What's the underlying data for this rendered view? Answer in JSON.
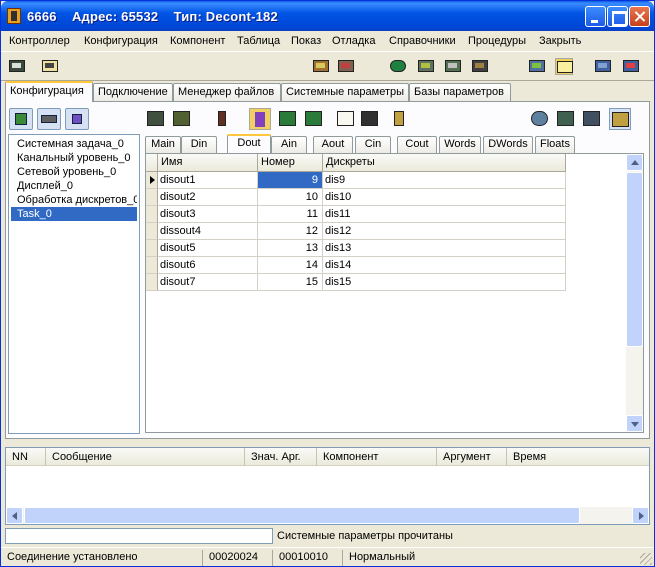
{
  "window": {
    "title": "6666    Адрес: 65532    Тип: Decont-182"
  },
  "menu": [
    "Контроллер",
    "Конфигурация",
    "Компонент",
    "Таблица",
    "Показ",
    "Отладка",
    "Справочники",
    "Процедуры",
    "Закрыть"
  ],
  "main_tabs": [
    "Конфигурация",
    "Подключение",
    "Менеджер файлов",
    "Системные параметры",
    "Базы параметров"
  ],
  "left_list": [
    "Системная задача_0",
    "Канальный уровень_0",
    "Сетевой уровень_0",
    "Дисплей_0",
    "Обработка дискретов_0",
    "Task_0"
  ],
  "left_selected": "Task_0",
  "sub_tabs": [
    "Main",
    "Din",
    "Dout",
    "Ain",
    "Aout",
    "Cin",
    "Cout",
    "Words",
    "DWords",
    "Floats"
  ],
  "active_sub_tab": "Dout",
  "grid": {
    "headers": [
      "Имя",
      "Номер",
      "Дискреты"
    ],
    "rows": [
      {
        "name": "disout1",
        "num": "9",
        "disc": "dis9"
      },
      {
        "name": "disout2",
        "num": "10",
        "disc": "dis10"
      },
      {
        "name": "disout3",
        "num": "11",
        "disc": "dis11"
      },
      {
        "name": "dissout4",
        "num": "12",
        "disc": "dis12"
      },
      {
        "name": "disout5",
        "num": "13",
        "disc": "dis13"
      },
      {
        "name": "disout6",
        "num": "14",
        "disc": "dis14"
      },
      {
        "name": "disout7",
        "num": "15",
        "disc": "dis15"
      }
    ]
  },
  "log_headers": [
    "NN",
    "Сообщение",
    "Знач. Арг.",
    "Компонент",
    "Аргумент",
    "Время"
  ],
  "message_input": {
    "value": ""
  },
  "message_text": "Системные параметры прочитаны",
  "status": [
    "Соединение установлено",
    "00020024",
    "00010010",
    "Нормальный"
  ]
}
